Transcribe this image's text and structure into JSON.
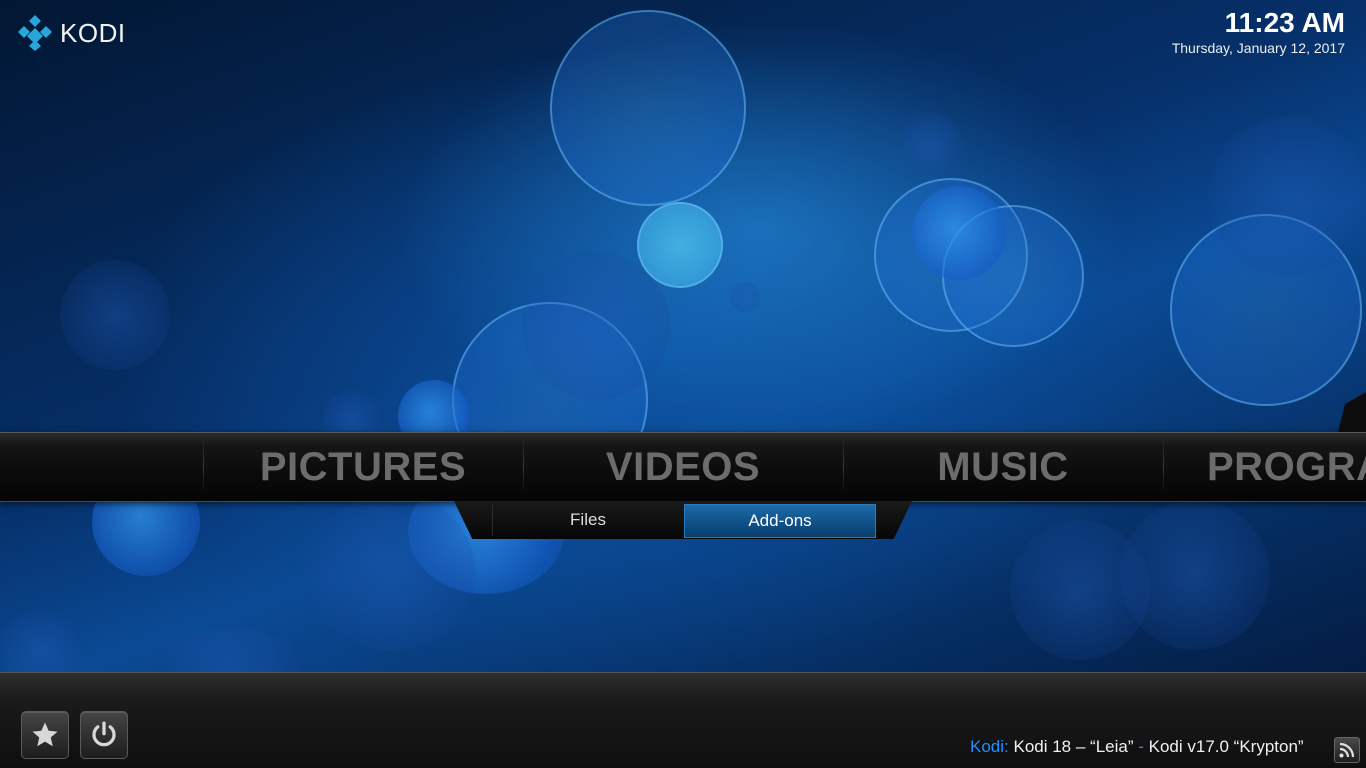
{
  "app": {
    "logo_text": "KODI"
  },
  "clock": {
    "time": "11:23 AM",
    "date": "Thursday, January 12, 2017"
  },
  "main_menu": {
    "items": [
      {
        "label": "PICTURES"
      },
      {
        "label": "VIDEOS"
      },
      {
        "label": "MUSIC"
      },
      {
        "label": "PROGRAMS"
      }
    ],
    "selected_index": 0
  },
  "submenu": {
    "items": [
      {
        "label": "Files"
      },
      {
        "label": "Add-ons"
      }
    ],
    "focused_index": 1
  },
  "bottom_bar": {
    "buttons": [
      {
        "icon": "star-icon",
        "name": "favourites"
      },
      {
        "icon": "power-icon",
        "name": "power"
      }
    ]
  },
  "rss": {
    "source": "Kodi:",
    "headline_1": "Kodi 18 – “Leia”",
    "separator": " - ",
    "headline_2": "Kodi v17.0 “Krypton”",
    "icon": "rss-icon"
  },
  "colors": {
    "accent": "#1e90ff",
    "selected_tab": "#1e6aa6",
    "menu_text": "#6c6c6c"
  }
}
